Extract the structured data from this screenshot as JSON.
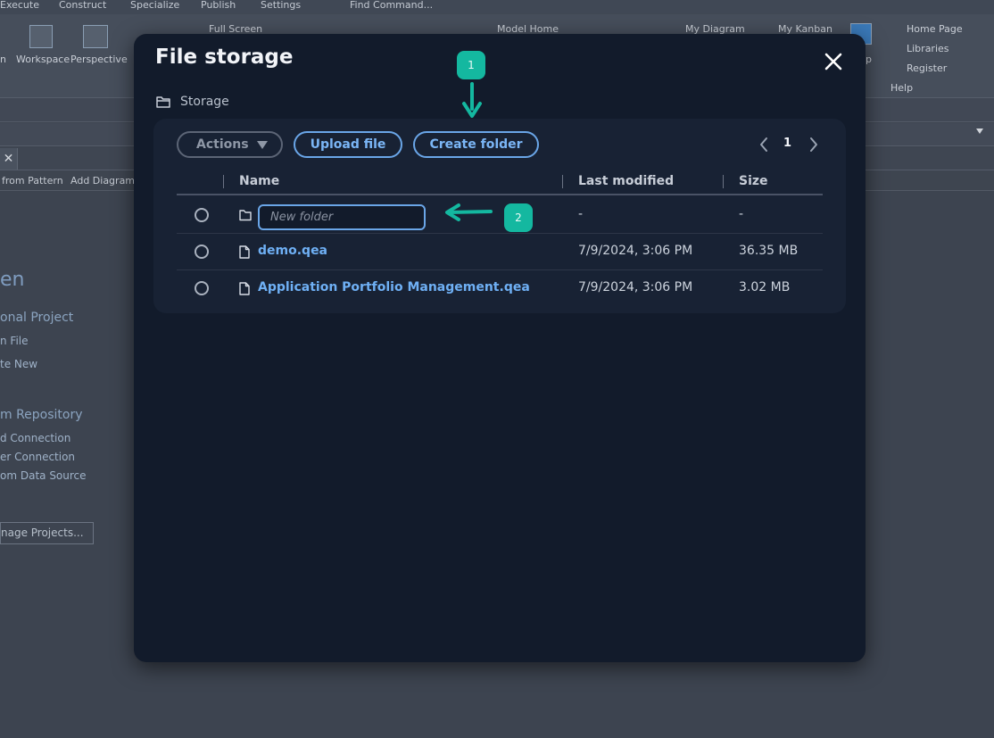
{
  "background": {
    "menu": [
      "Execute",
      "Construct",
      "Specialize",
      "Publish",
      "Settings",
      "Find Command..."
    ],
    "ribbon": {
      "workspace": "Workspace",
      "perspective": "Perspective",
      "full_screen": "Full Screen",
      "model_home": "Model Home",
      "my_diagram": "My Diagram",
      "my_kanban": "My Kanban",
      "help_group": [
        "Home Page",
        "Libraries",
        "Register"
      ],
      "help_label": "Help",
      "partial_n": "n",
      "partial_p": "p"
    },
    "toolstrip": [
      "from Pattern",
      "Add Diagram"
    ],
    "start_page": {
      "heading": "en",
      "items": [
        "onal Project",
        "n File",
        "te New"
      ],
      "repository_heading": "m Repository",
      "repository_items": [
        "d Connection",
        "er Connection",
        "om Data Source"
      ],
      "manage_button": "nage Projects..."
    }
  },
  "modal": {
    "title": "File storage",
    "breadcrumb": "Storage",
    "toolbar": {
      "actions_label": "Actions",
      "upload_label": "Upload file",
      "create_folder_label": "Create folder"
    },
    "pager": {
      "current_page": "1"
    },
    "table": {
      "headers": {
        "name": "Name",
        "last_modified": "Last modified",
        "size": "Size"
      },
      "new_folder": {
        "placeholder": "New folder",
        "last_modified": "-",
        "size": "-"
      },
      "rows": [
        {
          "name": "demo.qea",
          "last_modified": "7/9/2024, 3:06 PM",
          "size": "36.35 MB"
        },
        {
          "name": "Application Portfolio Management.qea",
          "last_modified": "7/9/2024, 3:06 PM",
          "size": "3.02 MB"
        }
      ]
    }
  },
  "annotations": {
    "step1": "1",
    "step2": "2",
    "color": "#14b8a0"
  }
}
